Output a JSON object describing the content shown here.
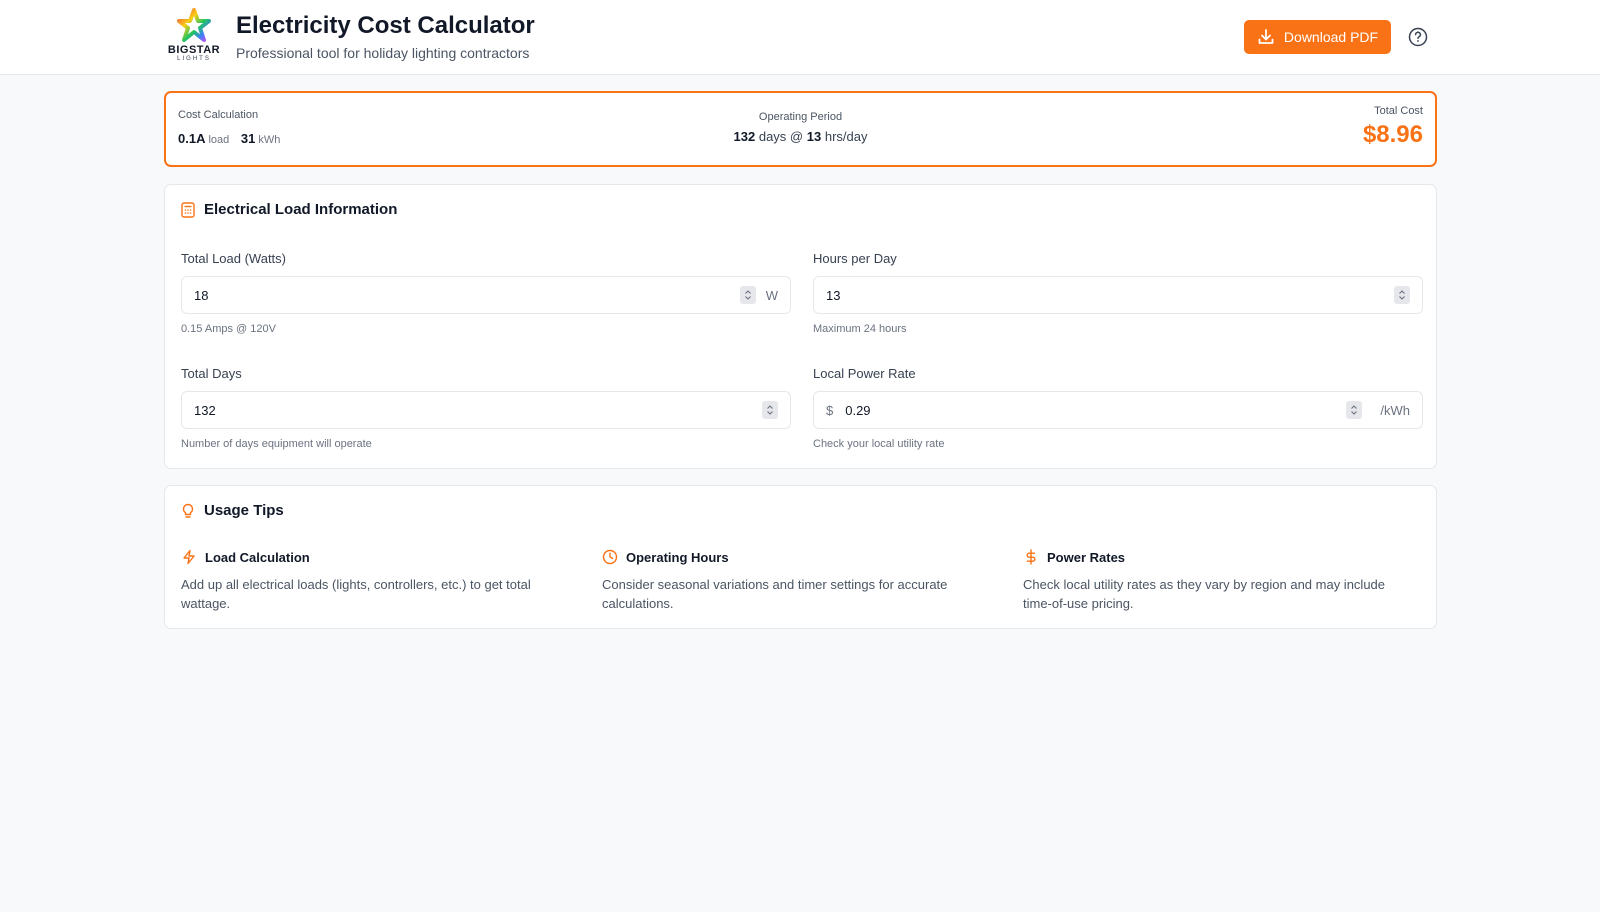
{
  "header": {
    "logo_text": "BIGSTAR",
    "logo_sub": "LIGHTS",
    "title": "Electricity Cost Calculator",
    "subtitle": "Professional tool for holiday lighting contractors",
    "download_label": "Download PDF",
    "help_icon": "help-circle-icon"
  },
  "summary": {
    "cost_calc_label": "Cost Calculation",
    "load_value": "0.1A",
    "load_unit": "load",
    "kwh_value": "31",
    "kwh_unit": "kWh",
    "period_label": "Operating Period",
    "days_value": "132",
    "days_text": "days @",
    "hours_value": "13",
    "hours_text": "hrs/day",
    "total_label": "Total Cost",
    "total_value": "$8.96"
  },
  "load_info": {
    "title": "Electrical Load Information",
    "icon": "calculator-icon",
    "total_load": {
      "label": "Total Load (Watts)",
      "value": "18",
      "suffix": "W",
      "hint": "0.15 Amps @ 120V"
    },
    "hours_per_day": {
      "label": "Hours per Day",
      "value": "13",
      "hint": "Maximum 24 hours"
    },
    "total_days": {
      "label": "Total Days",
      "value": "132",
      "hint": "Number of days equipment will operate"
    },
    "power_rate": {
      "label": "Local Power Rate",
      "prefix": "$",
      "value": "0.29",
      "suffix": "/kWh",
      "hint": "Check your local utility rate"
    }
  },
  "tips": {
    "title": "Usage Tips",
    "icon": "lightbulb-icon",
    "items": [
      {
        "title": "Load Calculation",
        "icon": "lightning-icon",
        "body": "Add up all electrical loads (lights, controllers, etc.) to get total wattage."
      },
      {
        "title": "Operating Hours",
        "icon": "clock-icon",
        "body": "Consider seasonal variations and timer settings for accurate calculations."
      },
      {
        "title": "Power Rates",
        "icon": "dollar-icon",
        "body": "Check local utility rates as they vary by region and may include time-of-use pricing."
      }
    ]
  },
  "colors": {
    "accent": "#f97316",
    "text": "#111827",
    "muted": "#6b7280",
    "border": "#e5e7eb",
    "background": "#f8f9fb"
  }
}
